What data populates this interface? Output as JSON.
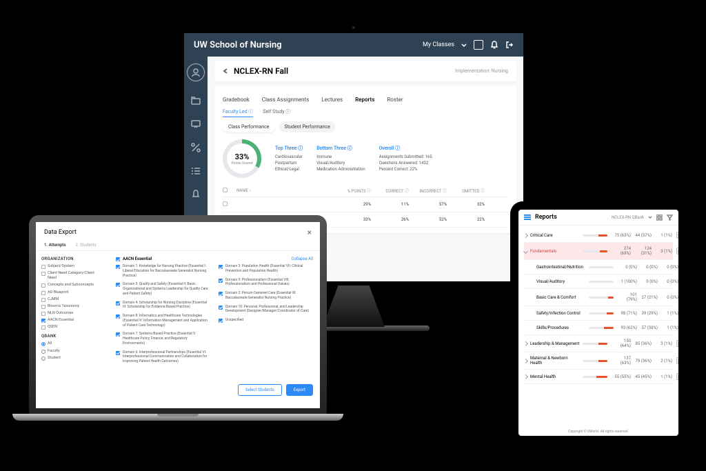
{
  "monitor": {
    "header": {
      "title": "UW School of Nursing",
      "my_classes": "My Classes"
    },
    "breadcrumb": "NCLEX-RN Fall",
    "breadcrumb_right": "Implementation: Nursing",
    "tabs": [
      "Gradebook",
      "Class Assignments",
      "Lectures",
      "Reports",
      "Roster"
    ],
    "active_tab": 3,
    "subtabs": [
      "Faculty Led",
      "Self Study"
    ],
    "perf_pills": [
      "Class Performance",
      "Student Performance"
    ],
    "ring_pct": "33%",
    "ring_label": "Points Scored",
    "top_three": {
      "head": "Top Three",
      "items": [
        "Cardiovascular",
        "Postpartum",
        "Ethical/Legal"
      ]
    },
    "bottom_three": {
      "head": "Bottom Three",
      "items": [
        "Immune",
        "Visual/Auditory",
        "Medication Administration"
      ]
    },
    "overall": {
      "head": "Overall",
      "items": [
        "Assignments Submitted: 165",
        "Questions Answered: 1432",
        "Percent Correct: 22%"
      ]
    },
    "table": {
      "cols": [
        "NAME",
        "% POINTS",
        "CORRECT",
        "INCORRECT",
        "OMITTED"
      ],
      "rows": [
        [
          "",
          "29%",
          "11%",
          "57%",
          "32%"
        ],
        [
          "",
          "33%",
          "26%",
          "52%",
          "22%"
        ]
      ]
    }
  },
  "laptop": {
    "title": "Data Export",
    "tabs": [
      "1. Attempts",
      "2. Students"
    ],
    "org_label": "ORGANIZATION",
    "org_items": [
      {
        "label": "Subject/System",
        "on": false
      },
      {
        "label": "Client Need Category/Client Need",
        "on": false
      },
      {
        "label": "Concepts and Subconcepts",
        "on": false
      },
      {
        "label": "AD Blueprint",
        "on": false
      },
      {
        "label": "CJMM",
        "on": false
      },
      {
        "label": "Bloom's Taxonomy",
        "on": false
      },
      {
        "label": "NLN Outcomes",
        "on": false
      },
      {
        "label": "AACN Essential",
        "on": true
      },
      {
        "label": "QSEN",
        "on": false
      }
    ],
    "qbank_label": "QBANK",
    "qbank_items": [
      {
        "label": "All",
        "on": true
      },
      {
        "label": "Faculty",
        "on": false
      },
      {
        "label": "Student",
        "on": false
      }
    ],
    "group_title": "AACN Essential",
    "collapse": "Collapse All",
    "domains_left": [
      "Domain 1: Knowledge for Nursing Practice (Essential I: Liberal Education for Baccalaureate Generalist Nursing Practice)",
      "Domain 5: Quality and Safety (Essential II: Basic Organizational and Systems Leadership for Quality Care and Patient Safety)",
      "Domain 4: Scholarship for Nursing Discipline (Essential III: Scholarship for Evidence-Based Practice)",
      "Domain 8: Informatics and Healthcare Technologies (Essential IV: Information Management and Application of Patient Care Technology)",
      "Domain 7: Systems-Based Practice (Essential V: Healthcare Policy, Finance, and Regulatory Environments)",
      "Domain 6: Interprofessional Partnerships (Essential VI: Interprofessional Communication and Collaboration for Improving Patient Health Outcomes)"
    ],
    "domains_right": [
      "Domain 3: Population Health (Essential VII: Clinical Prevention and Population Health)",
      "Domain 9: Professionalism (Essential VIII: Professionalism and Professional Values)",
      "Domain 2: Person-Centered Care (Essential IX: Baccalaureate Generalist Nursing Practice)",
      "Domain 10: Personal, Professional, and Leadership Development (Designer/Manager/Coordinator of Care)",
      "Unspecified"
    ],
    "btn_select": "Select Students",
    "btn_export": "Export"
  },
  "tablet": {
    "title": "Reports",
    "selector": "NCLEX-RN QBank",
    "rows": [
      {
        "name": "Critical Care",
        "g": 63,
        "r": 37,
        "c1": "75 (63%)",
        "c2": "44 (37%)",
        "c3": "1 (1%)",
        "top": true,
        "new": false
      },
      {
        "name": "Fundamentals",
        "g": 69,
        "r": 31,
        "c1": "274 (69%)",
        "c2": "124 (31%)",
        "c3": "3 (1%)",
        "top": true,
        "new": true,
        "open": true
      },
      {
        "name": "Gastrointestinal/Nutrition",
        "g": 0,
        "r": 0,
        "c1": "0 (0%)",
        "c2": "0 (0%)",
        "c3": "0 (0%)",
        "child": true
      },
      {
        "name": "Visual/Auditory",
        "g": 100,
        "r": 0,
        "c1": "1 (100%)",
        "c2": "0 (0%)",
        "c3": "0 (0%)",
        "child": true
      },
      {
        "name": "Basic Care & Comfort",
        "g": 79,
        "r": 21,
        "c1": "101 (79%)",
        "c2": "27 (21%)",
        "c3": "0 (0%)",
        "child": true
      },
      {
        "name": "Safety/Infection Control",
        "g": 71,
        "r": 29,
        "c1": "98 (71%)",
        "c2": "39 (29%)",
        "c3": "1 (1%)",
        "child": true
      },
      {
        "name": "Skills/Procedures",
        "g": 62,
        "r": 38,
        "c1": "93 (62%)",
        "c2": "57 (38%)",
        "c3": "1 (1%)",
        "child": true
      },
      {
        "name": "Leadership & Management",
        "g": 64,
        "r": 36,
        "c1": "150 (64%)",
        "c2": "85 (36%)",
        "c3": "3 (1%)",
        "top": true
      },
      {
        "name": "Maternal & Newborn Health",
        "g": 63,
        "r": 37,
        "c1": "137 (63%)",
        "c2": "79 (36%)",
        "c3": "2 (1%)",
        "top": true
      },
      {
        "name": "Mental Health",
        "g": 55,
        "r": 45,
        "c1": "55 (55%)",
        "c2": "45 (45%)",
        "c3": "1 (1%)",
        "top": true
      }
    ],
    "footer": "Copyright © UWorld. All rights reserved."
  }
}
